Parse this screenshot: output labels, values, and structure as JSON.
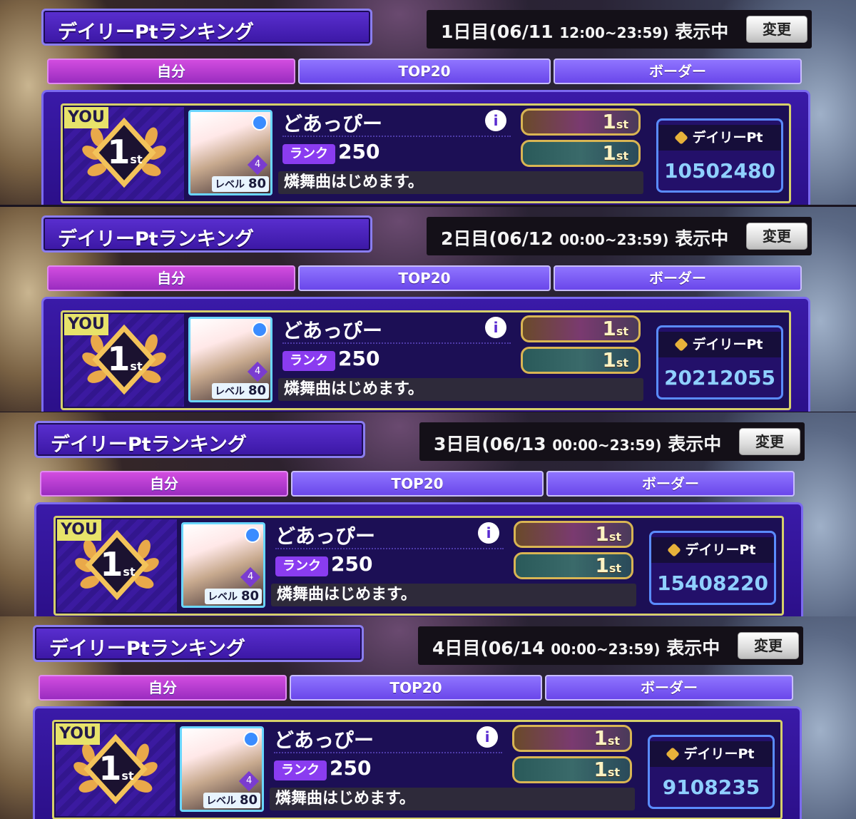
{
  "panel_title": "デイリーPtランキング",
  "change_label": "変更",
  "tabs": [
    "自分",
    "TOP20",
    "ボーダー"
  ],
  "you_label": "YOU",
  "rank_number": "1",
  "rank_suffix": "st",
  "player": {
    "name": "どあっぴー",
    "rank_label": "ランク",
    "rank_value": "250",
    "comment": "燐舞曲はじめます。",
    "level_label": "レベル",
    "level_value": "80",
    "star_count": "4",
    "info_icon": "i"
  },
  "title_badges": [
    {
      "text": "1",
      "suffix": "st"
    },
    {
      "text": "1",
      "suffix": "st"
    }
  ],
  "pt_label": "デイリーPt",
  "days": [
    {
      "day": "1日目",
      "date": "(06/11",
      "time": "12:00~23:59)",
      "status": "表示中",
      "points": "10502480"
    },
    {
      "day": "2日目",
      "date": "(06/12",
      "time": "00:00~23:59)",
      "status": "表示中",
      "points": "20212055"
    },
    {
      "day": "3日目",
      "date": "(06/13",
      "time": "00:00~23:59)",
      "status": "表示中",
      "points": "15408220"
    },
    {
      "day": "4日目",
      "date": "(06/14",
      "time": "00:00~23:59)",
      "status": "表示中",
      "points": "9108235"
    }
  ]
}
